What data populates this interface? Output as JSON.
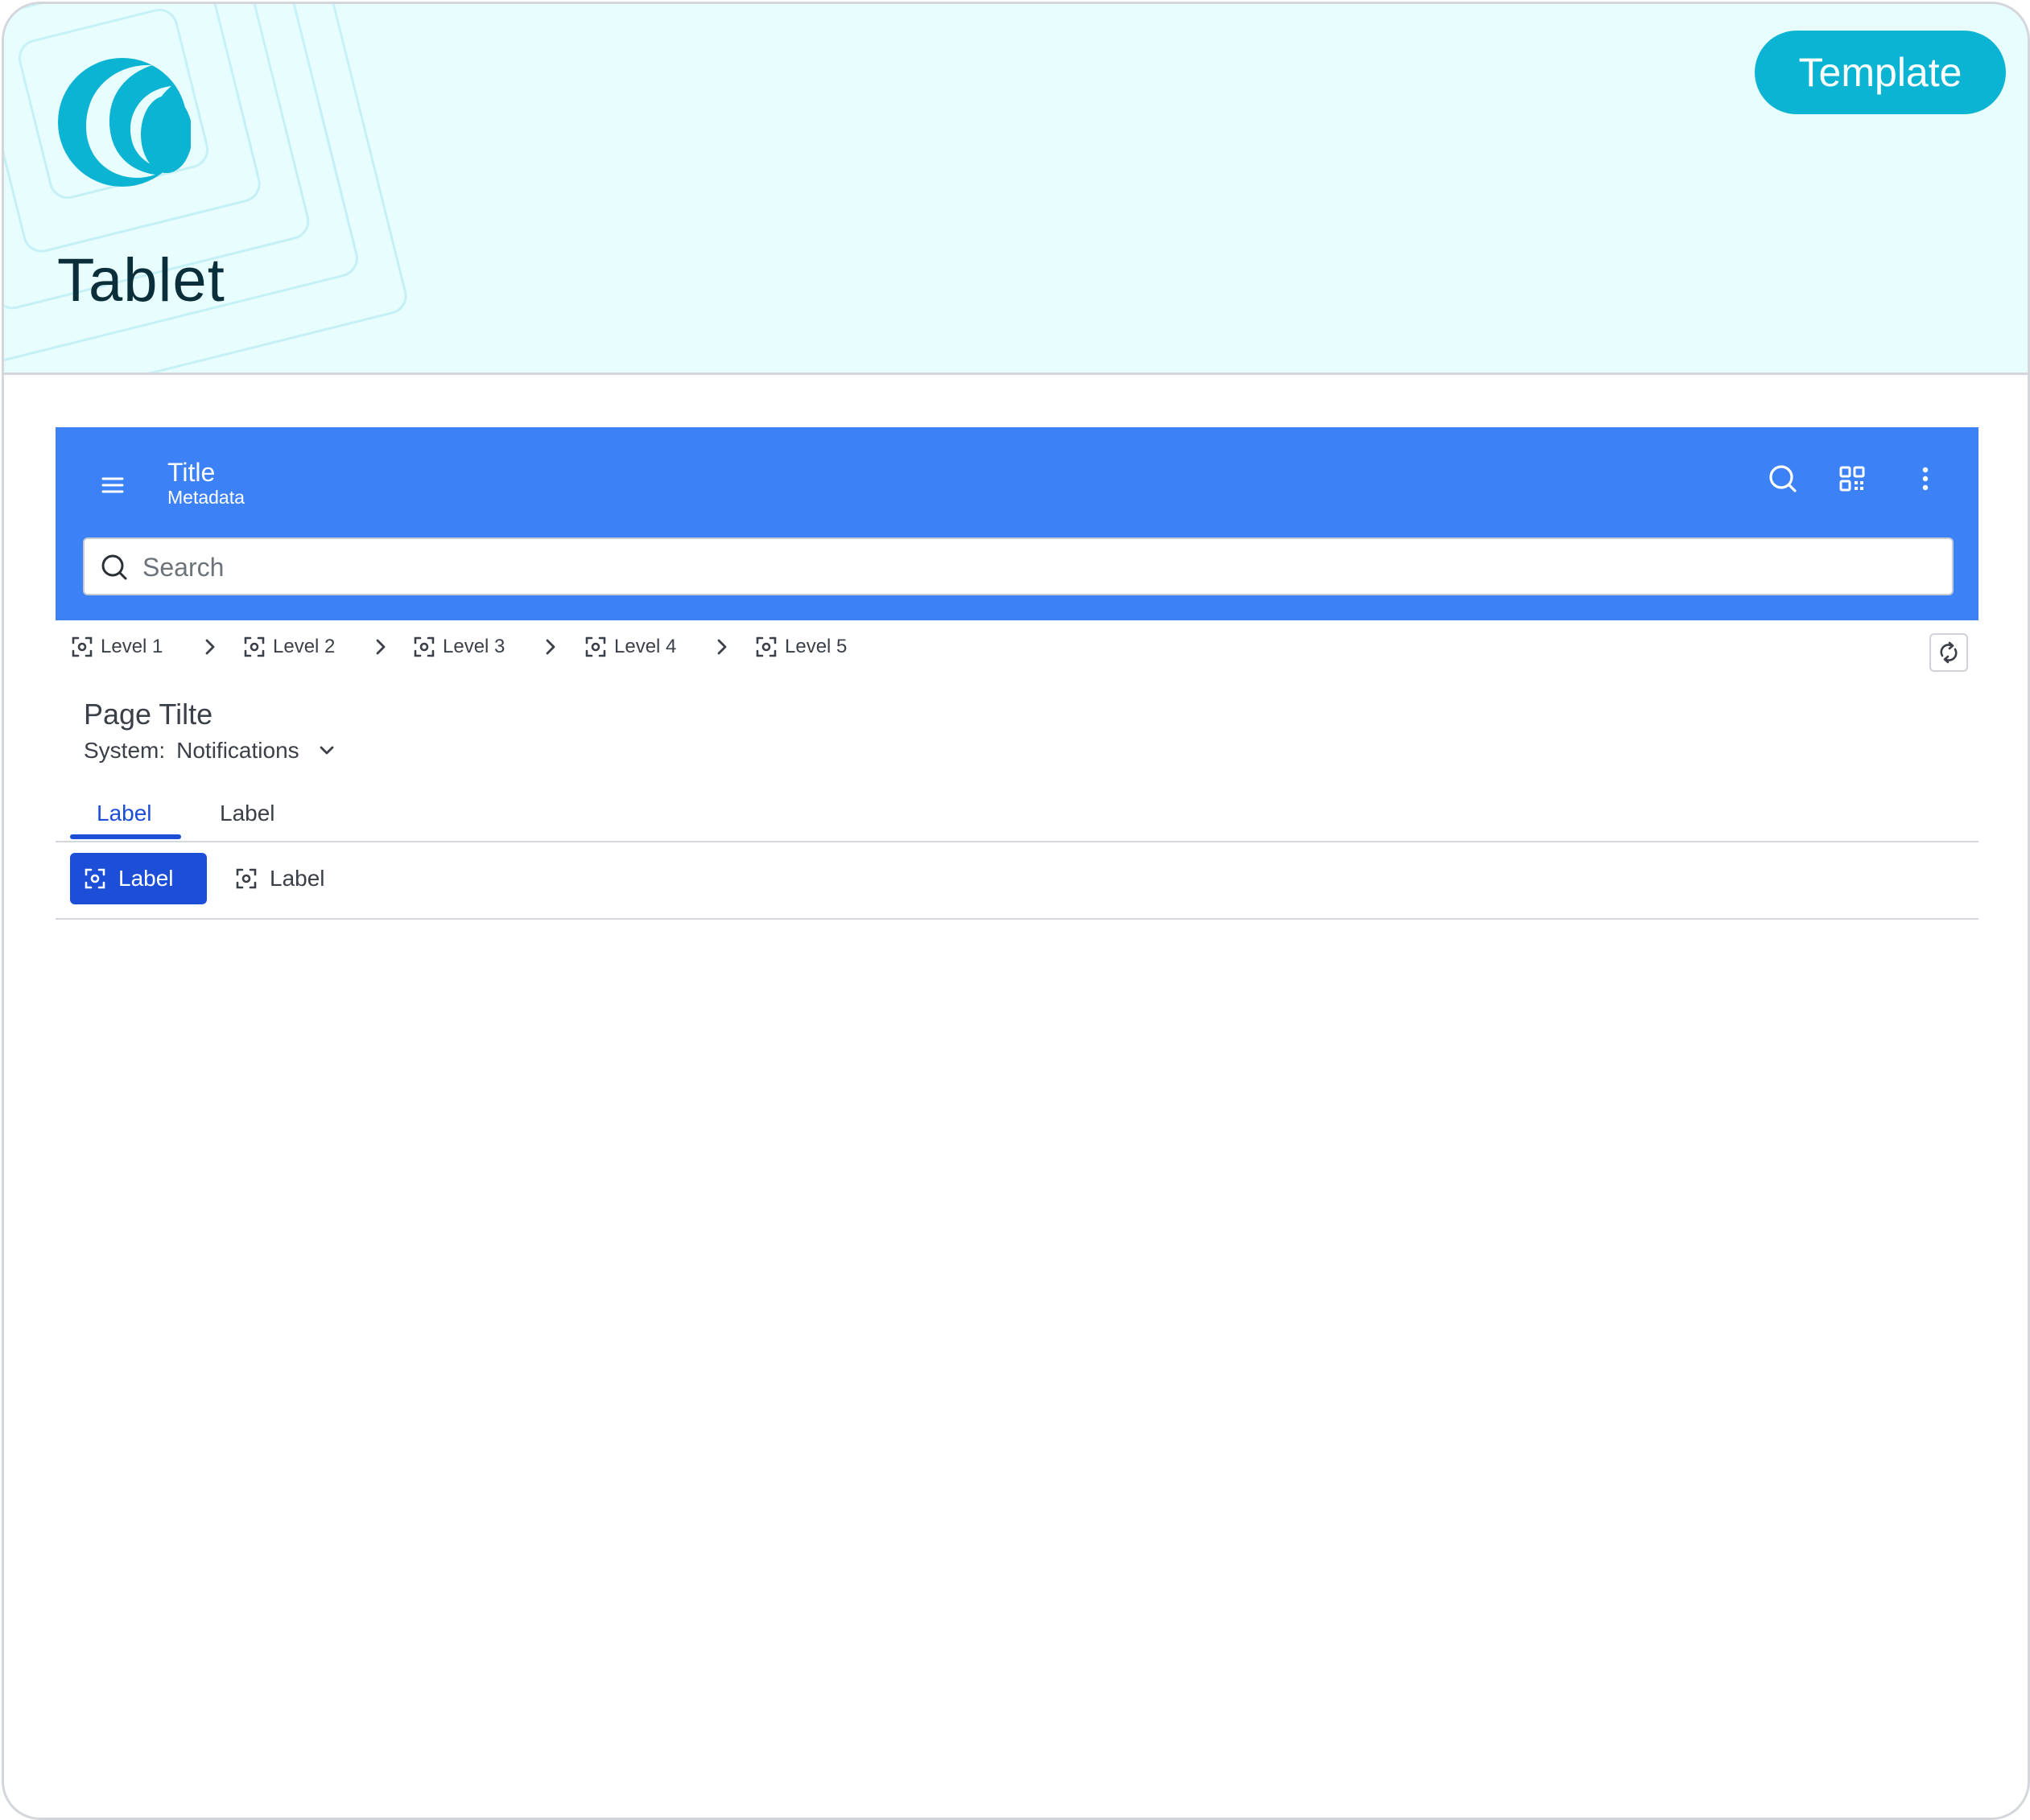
{
  "banner": {
    "title": "Tablet",
    "badge_label": "Template",
    "accent_color": "#0bb4d2",
    "background_color": "#e8fdfe"
  },
  "appbar": {
    "title": "Title",
    "metadata": "Metadata",
    "color": "#3c82f6",
    "icons": [
      "menu-icon",
      "search-icon",
      "qr-code-icon",
      "more-vertical-icon"
    ]
  },
  "search": {
    "placeholder": "Search",
    "value": ""
  },
  "breadcrumb": {
    "items": [
      {
        "label": "Level  1",
        "icon": "focus-icon"
      },
      {
        "label": "Level 2",
        "icon": "focus-icon"
      },
      {
        "label": "Level 3",
        "icon": "focus-icon"
      },
      {
        "label": "Level 4",
        "icon": "focus-icon"
      },
      {
        "label": "Level 5",
        "icon": "focus-icon"
      }
    ],
    "refresh_icon": "refresh-icon"
  },
  "page": {
    "title": "Page Tilte",
    "system_label": "System:",
    "system_value": "Notifications"
  },
  "tabs": [
    {
      "label": "Label",
      "active": true
    },
    {
      "label": "Label",
      "active": false
    }
  ],
  "toolbar": {
    "buttons": [
      {
        "label": "Label",
        "icon": "focus-icon",
        "selected": true
      },
      {
        "label": "Label",
        "icon": "focus-icon",
        "selected": false
      }
    ],
    "primary_color": "#1d4ed8"
  }
}
